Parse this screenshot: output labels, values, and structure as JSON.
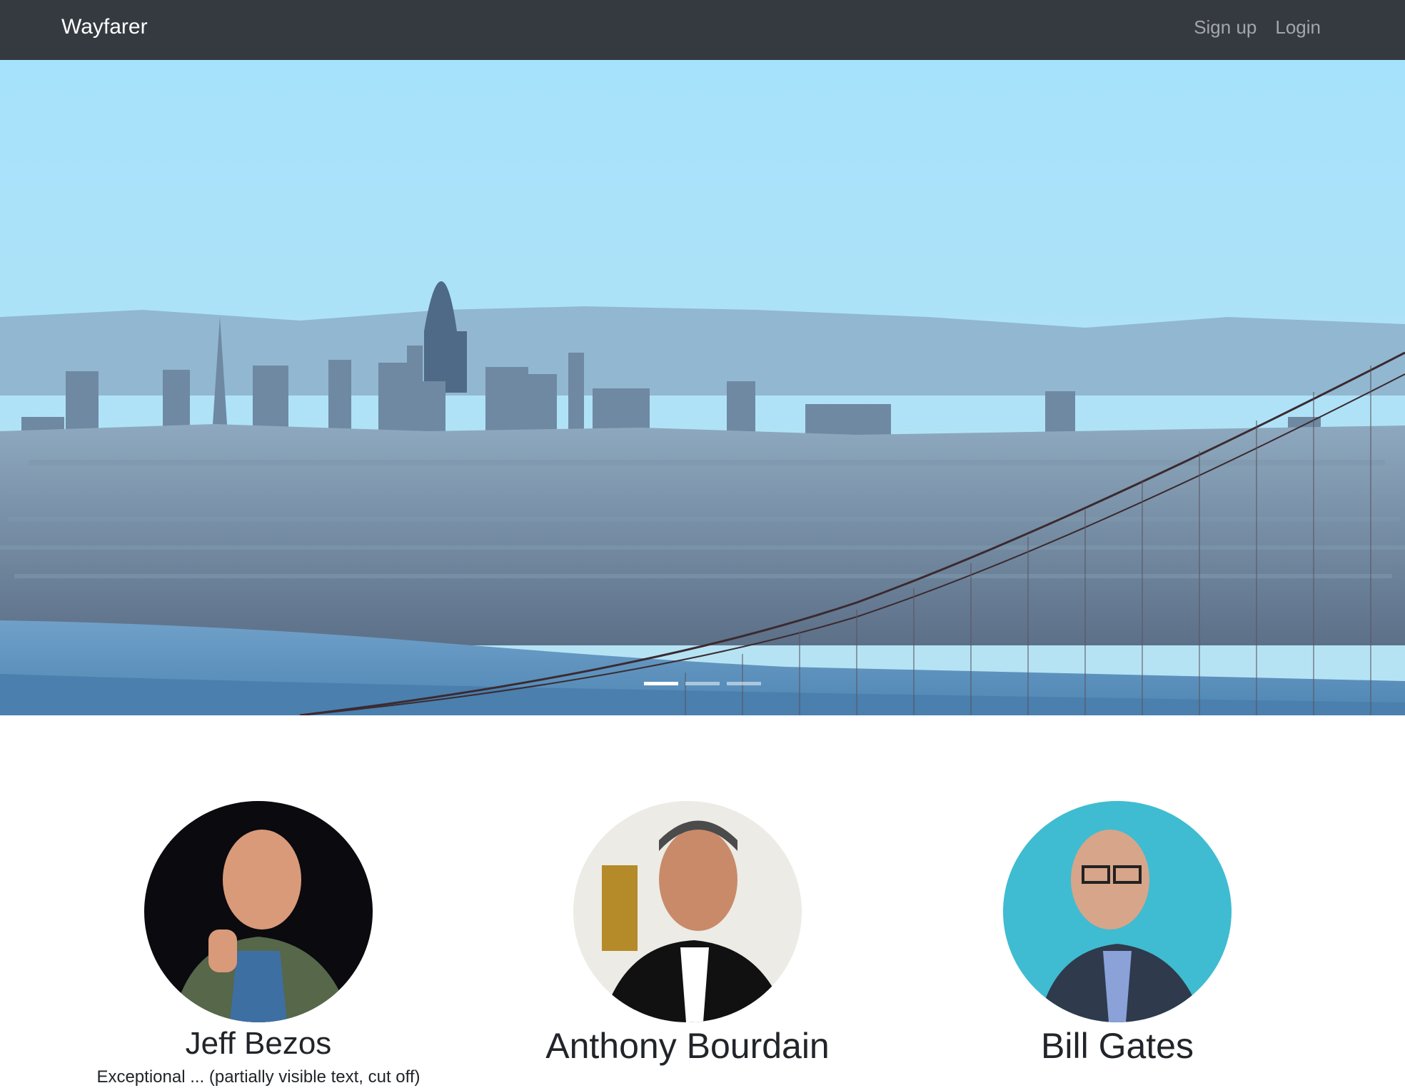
{
  "navbar": {
    "brand": "Wayfarer",
    "links": [
      {
        "label": "Sign up"
      },
      {
        "label": "Login"
      }
    ]
  },
  "carousel": {
    "slide_count": 3,
    "active_index": 0
  },
  "profiles": [
    {
      "name": "Jeff Bezos",
      "description": "Exceptional ... (partially visible text, cut off)"
    },
    {
      "name": "Anthony Bourdain",
      "description": ""
    },
    {
      "name": "Bill Gates",
      "description": ""
    }
  ],
  "colors": {
    "navbar_bg": "#343a40",
    "brand_text": "#ffffff",
    "nav_link_text": "rgba(255,255,255,0.55)",
    "sky": "#9fdcf7",
    "water": "#5b8fb8"
  },
  "icons": {
    "avatars": [
      "person-photo-icon",
      "person-photo-icon",
      "person-photo-icon"
    ]
  }
}
